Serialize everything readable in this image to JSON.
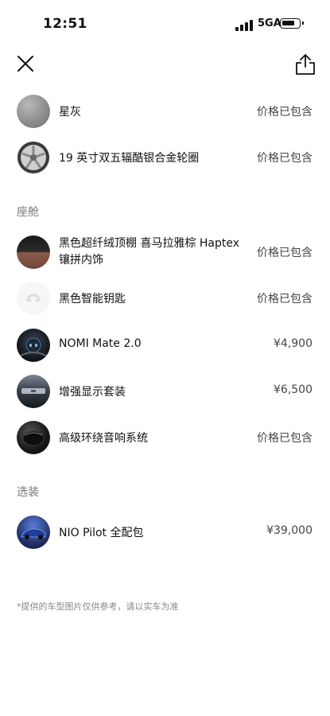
{
  "status_bar": {
    "time": "12:51",
    "network": "5GA"
  },
  "header": {
    "close_icon": "close-icon",
    "share_icon": "share-icon"
  },
  "items_top": [
    {
      "name": "星灰",
      "price": "价格已包含",
      "icon": "gray-paint-swatch"
    },
    {
      "name": "19 英寸双五辐酷银合金轮圈",
      "price": "价格已包含",
      "icon": "wheel-rim"
    }
  ],
  "section_cabin": {
    "title": "座舱",
    "items": [
      {
        "name": "黑色超纤绒顶棚 喜马拉雅棕 Haptex 镶拼内饰",
        "price": "价格已包含",
        "icon": "interior-swatch"
      },
      {
        "name": "黑色智能钥匙",
        "price": "价格已包含",
        "icon": "smart-key"
      },
      {
        "name": "NOMI Mate 2.0",
        "price": "¥4,900",
        "icon": "nomi-mate"
      },
      {
        "name": "增强显示套装",
        "price": "¥6,500",
        "icon": "display-pack"
      },
      {
        "name": "高级环绕音响系统",
        "price": "价格已包含",
        "icon": "speaker"
      }
    ]
  },
  "section_options": {
    "title": "选装",
    "items": [
      {
        "name": "NIO Pilot 全配包",
        "price": "¥39,000",
        "icon": "car-thumbnail"
      }
    ]
  },
  "disclaimer": "*提供的车型图片仅供参考，请以实车为准"
}
